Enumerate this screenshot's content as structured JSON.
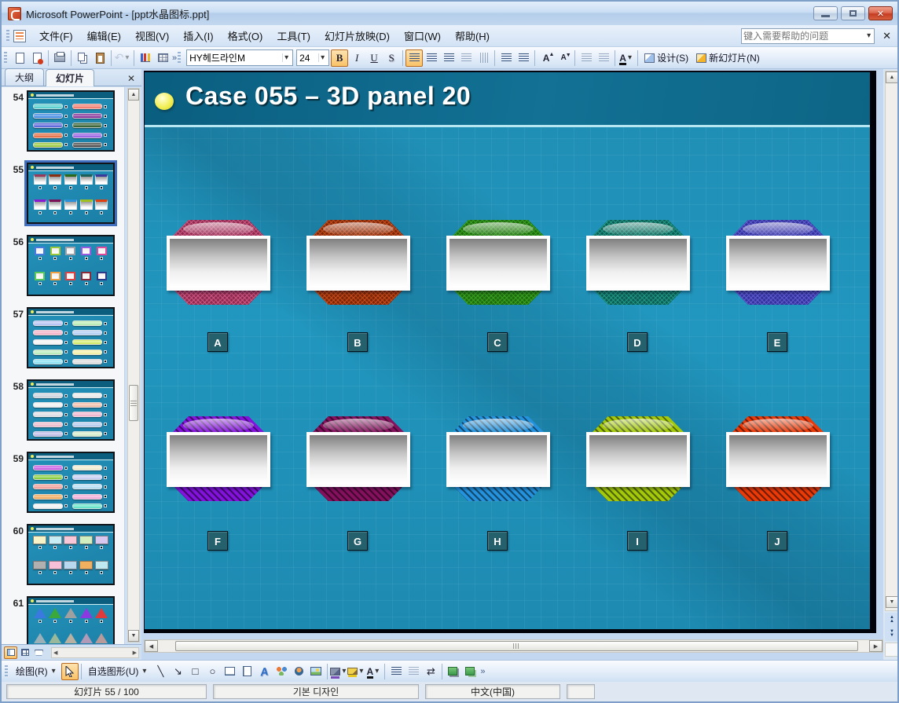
{
  "titlebar": {
    "title": "Microsoft PowerPoint - [ppt水晶图标.ppt]"
  },
  "menubar": {
    "items": [
      "文件(F)",
      "编辑(E)",
      "视图(V)",
      "插入(I)",
      "格式(O)",
      "工具(T)",
      "幻灯片放映(D)",
      "窗口(W)",
      "帮助(H)"
    ],
    "help_placeholder": "键入需要帮助的问题"
  },
  "toolbar": {
    "font_name": "HY헤드라인M",
    "font_size": "24",
    "bold_label": "B",
    "italic_label": "I",
    "underline_label": "U",
    "shadow_label": "S",
    "grow_font_label": "A",
    "shrink_font_label": "A",
    "font_color_label": "A",
    "design_label": "设计(S)",
    "new_slide_label": "新幻灯片(N)"
  },
  "sidebar": {
    "tab_outline": "大纲",
    "tab_slides": "幻灯片",
    "thumbnails": [
      {
        "num": "54",
        "type": "pills",
        "selected": false,
        "left": [
          "#3fc8c8",
          "#2f7fe0",
          "#4553d6",
          "#e05a2a",
          "#8fc32a"
        ],
        "right": [
          "#ef6a5a",
          "#7a1f8e",
          "#1d4d1a",
          "#8a4ae0",
          "#3a3a3a"
        ]
      },
      {
        "num": "55",
        "type": "panels",
        "selected": true,
        "top": [
          "#9a3a5a",
          "#8a3010",
          "#2a6a1a",
          "#1a6058",
          "#3a3a9a"
        ],
        "bottom": [
          "#8a1ad0",
          "#7a1055",
          "#2a90d8",
          "#a0c020",
          "#e04010"
        ]
      },
      {
        "num": "56",
        "type": "squares",
        "selected": false,
        "top": [
          "#4a7ae0",
          "#9ac83a",
          "#a0a0a8",
          "#9a5ae0",
          "#e04a9a"
        ],
        "bottom": [
          "#5ac85a",
          "#f0a040",
          "#e04040",
          "#8a2a3a",
          "#2a3a8a"
        ]
      },
      {
        "num": "57",
        "type": "pills",
        "selected": false,
        "left": [
          "#aebcf2",
          "#f2a8c0",
          "#f2f2f2",
          "#b2e8b2",
          "#7adef2"
        ],
        "right": [
          "#b2e8a8",
          "#a8c8f2",
          "#cde85a",
          "#f2ee9a",
          "#d8d8d8"
        ]
      },
      {
        "num": "58",
        "type": "pills",
        "selected": false,
        "left": [
          "#c4ccd8",
          "#eeeeee",
          "#d8d8e0",
          "#eab2c4",
          "#b8b4e4"
        ],
        "right": [
          "#e6e6e6",
          "#f0b49c",
          "#eeaac6",
          "#aac2ea",
          "#cfe8c2"
        ]
      },
      {
        "num": "59",
        "type": "pills",
        "selected": false,
        "left": [
          "#c24ae0",
          "#7ac828",
          "#f09088",
          "#f0a048",
          "#f0f0f0"
        ],
        "right": [
          "#f0e8c8",
          "#c0c8f0",
          "#a8d8f0",
          "#f0a0d0",
          "#50e0c0"
        ]
      },
      {
        "num": "60",
        "type": "rects",
        "selected": false,
        "top": [
          "#f8f4c8",
          "#c8ecf4",
          "#f8c8d8",
          "#d0eec0",
          "#d8c8f0"
        ],
        "bottom": [
          "#b0b0b0",
          "#f8c0d8",
          "#b8d8f0",
          "#f0b060",
          "#c0e8f0"
        ]
      },
      {
        "num": "61",
        "type": "triangles",
        "selected": false,
        "top": [
          "#3a7ae0",
          "#3aa83a",
          "#a0a0a0",
          "#8a3ae0",
          "#e03a3a"
        ],
        "bottom": [
          "#9ab0b8",
          "#9ab89a",
          "#b8b0a0",
          "#b09ab8",
          "#b89a9a"
        ]
      }
    ]
  },
  "slide": {
    "title": "Case 055 – 3D panel 20",
    "panels": [
      {
        "label": "A",
        "color": "#8e2a52",
        "accent": "#ff7ba0",
        "pattern": "cross"
      },
      {
        "label": "B",
        "color": "#7e2606",
        "accent": "#ff6a30",
        "pattern": "cross"
      },
      {
        "label": "C",
        "color": "#1e6b10",
        "accent": "#4fd02c",
        "pattern": "cross"
      },
      {
        "label": "D",
        "color": "#0e5d55",
        "accent": "#2fc9a9",
        "pattern": "cross"
      },
      {
        "label": "E",
        "color": "#35339b",
        "accent": "#7f7dfa",
        "pattern": "cross"
      },
      {
        "label": "F",
        "color": "#8312dc",
        "accent": "#000000",
        "pattern": "stripe"
      },
      {
        "label": "G",
        "color": "#85105e",
        "accent": "#000000",
        "pattern": "stripe"
      },
      {
        "label": "H",
        "color": "#2492dc",
        "accent": "#000000",
        "pattern": "stripe"
      },
      {
        "label": "I",
        "color": "#a3c90a",
        "accent": "#000000",
        "pattern": "stripe"
      },
      {
        "label": "J",
        "color": "#ea3a08",
        "accent": "#000000",
        "pattern": "stripe"
      }
    ],
    "label_bg": "#25606d",
    "background_teal": "#2196be",
    "title_band": "#0e6787"
  },
  "drawbar": {
    "draw_label": "绘图(R)",
    "autoshapes_label": "自选图形(U)"
  },
  "statusbar": {
    "slide_info": "幻灯片 55 / 100",
    "design_name": "기본 디자인",
    "language": "中文(中国)"
  },
  "icons": {
    "close": "✕",
    "dropdown": "▾",
    "overflow": "»",
    "undo": "↶",
    "line": "╲",
    "arrow": "↘",
    "rect": "□",
    "oval": "○",
    "arrow_style": "⇄",
    "up": "▲",
    "down": "▼",
    "left": "◀",
    "right": "▶",
    "grow_mark": "▲",
    "shrink_mark": "▼"
  }
}
